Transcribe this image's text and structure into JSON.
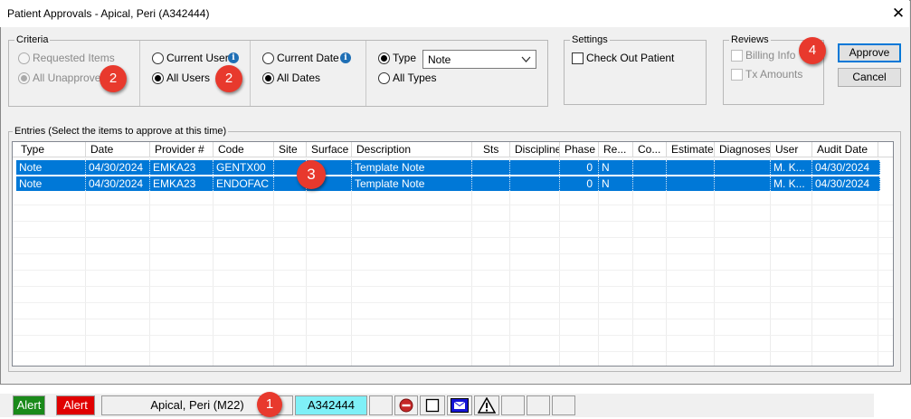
{
  "window": {
    "title": "Patient Approvals - Apical, Peri (A342444)",
    "close_glyph": "✕"
  },
  "criteria": {
    "legend": "Criteria",
    "requested_items": "Requested Items",
    "all_unapproved": "All Unapproved",
    "current_user": "Current User",
    "all_users": "All Users",
    "current_date": "Current Date",
    "all_dates": "All Dates",
    "type": "Type",
    "type_value": "Note",
    "all_types": "All Types",
    "info_glyph": "i"
  },
  "settings": {
    "legend": "Settings",
    "check_out_patient": "Check Out Patient"
  },
  "reviews": {
    "legend": "Reviews",
    "billing_info": "Billing Info",
    "tx_amounts": "Tx Amounts"
  },
  "buttons": {
    "approve": "Approve",
    "cancel": "Cancel"
  },
  "entries": {
    "legend": "Entries (Select the items to approve at this time)",
    "columns": [
      "Type",
      "Date",
      "Provider #",
      "Code",
      "Site",
      "Surface",
      "Description",
      "Sts",
      "Discipline",
      "Phase",
      "Re...",
      "Co...",
      "Estimate",
      "Diagnoses",
      "User",
      "Audit Date"
    ],
    "rows": [
      [
        "Note",
        "04/30/2024",
        "EMKA23",
        "GENTX00",
        "",
        "",
        "Template Note",
        "",
        "",
        "0",
        "N",
        "",
        "",
        "",
        "M. K...",
        "04/30/2024"
      ],
      [
        "Note",
        "04/30/2024",
        "EMKA23",
        "ENDOFAC",
        "",
        "",
        "Template Note",
        "",
        "",
        "0",
        "N",
        "",
        "",
        "",
        "M. K...",
        "04/30/2024"
      ]
    ]
  },
  "callouts": {
    "c1": "1",
    "c2a": "2",
    "c2b": "2",
    "c3": "3",
    "c4": "4"
  },
  "statusbar": {
    "alert1": "Alert",
    "alert2": "Alert",
    "patient": "Apical, Peri (M22)",
    "chart_id": "A342444",
    "alert1_color": "#1a8a1a",
    "alert2_color": "#e00000",
    "chart_id_color": "#7ff0f7"
  }
}
